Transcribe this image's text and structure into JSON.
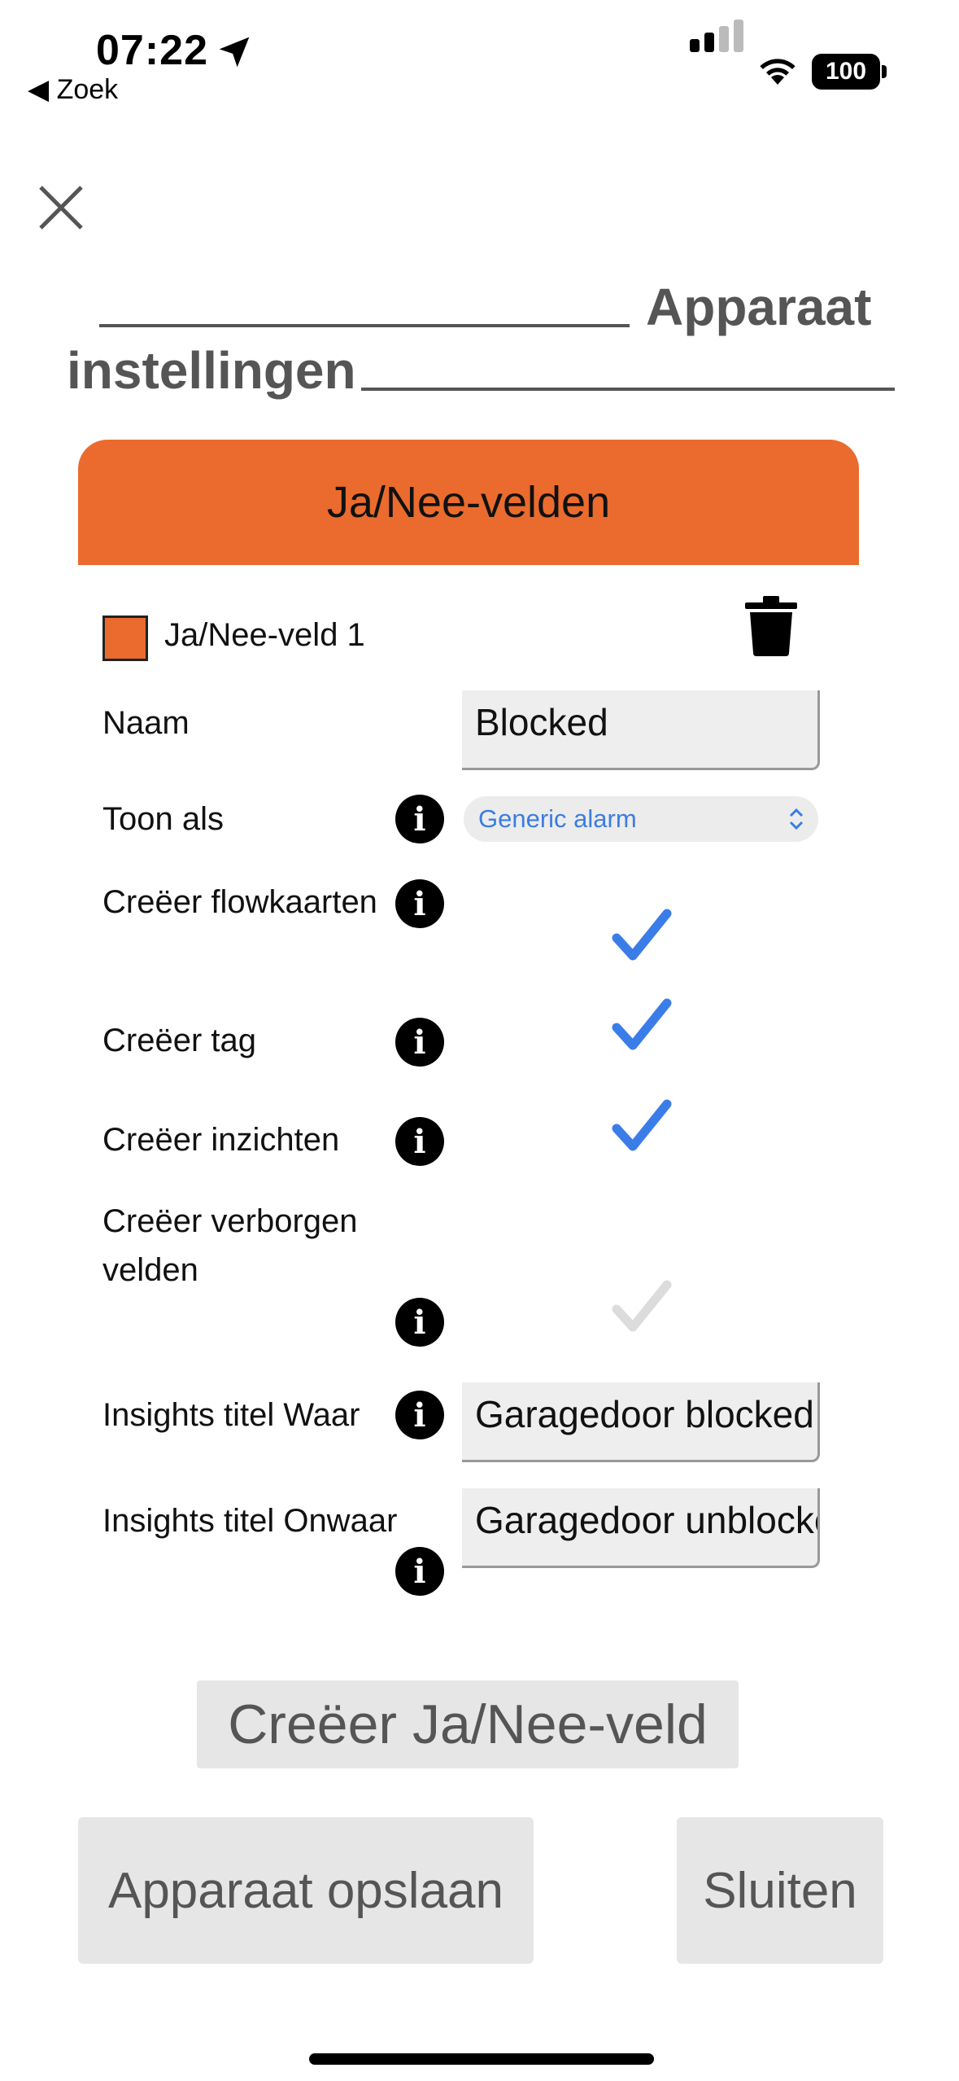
{
  "status_bar": {
    "time": "07:22",
    "back_label": "Zoek",
    "battery": "100"
  },
  "page": {
    "title": "Apparaat instellingen",
    "title_word1": "Apparaat",
    "title_word2": "instellingen"
  },
  "section": {
    "header": "Ja/Nee-velden",
    "accent_color": "#ea6b2d"
  },
  "field": {
    "title": "Ja/Nee-veld 1",
    "rows": {
      "name_label": "Naam",
      "name_value": "Blocked",
      "show_as_label": "Toon als",
      "show_as_value": "Generic alarm",
      "flowcards_label": "Creëer flowkaarten",
      "flowcards_checked": true,
      "tag_label": "Creëer tag",
      "tag_checked": true,
      "insights_label": "Creëer inzichten",
      "insights_checked": true,
      "hidden_label_line1": "Creëer verborgen",
      "hidden_label_line2": "velden",
      "hidden_checked": false,
      "insights_true_label": "Insights titel Waar",
      "insights_true_value": "Garagedoor blocked",
      "insights_false_label": "Insights titel Onwaar",
      "insights_false_value": "Garagedoor unblocked"
    }
  },
  "buttons": {
    "create": "Creëer Ja/Nee-veld",
    "save": "Apparaat opslaan",
    "close": "Sluiten"
  },
  "icons": {
    "close": "close-icon",
    "trash": "trash-icon",
    "info": "info-icon",
    "check": "checkmark-icon"
  }
}
